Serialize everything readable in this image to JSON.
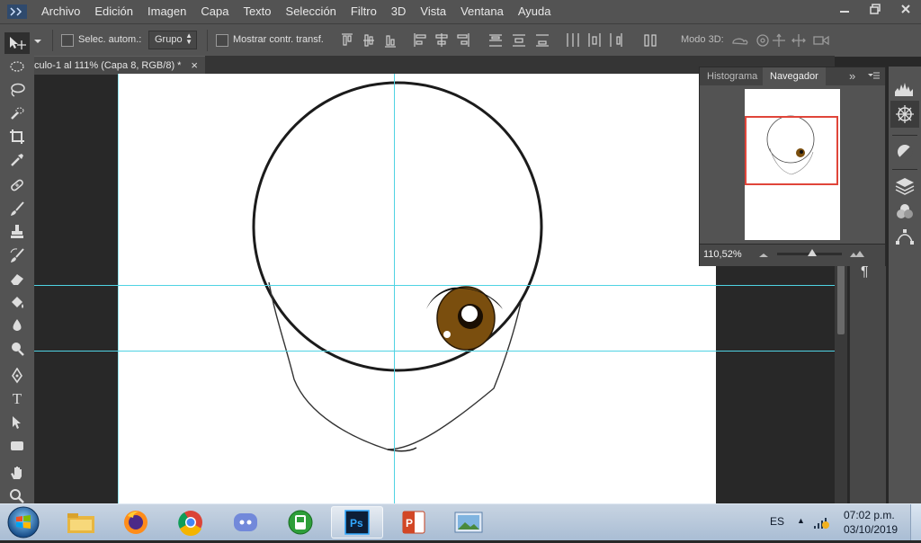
{
  "menu": {
    "items": [
      "Archivo",
      "Edición",
      "Imagen",
      "Capa",
      "Texto",
      "Selección",
      "Filtro",
      "3D",
      "Vista",
      "Ventana",
      "Ayuda"
    ]
  },
  "options_bar": {
    "auto_select_label": "Selec. autom.:",
    "group_select_value": "Grupo",
    "show_transform_label": "Mostrar contr. transf.",
    "mode_3d_label": "Modo 3D:"
  },
  "document": {
    "tab_title": "culo-1 al 111% (Capa 8, RGB/8) *",
    "tab_close": "×"
  },
  "navigator_panel": {
    "tabs": [
      "Histograma",
      "Navegador"
    ],
    "active_tab": "Navegador",
    "zoom_value": "110,52%",
    "double_arrow": "»"
  },
  "side_panel": {
    "paragraph_glyph": "¶"
  },
  "taskbar": {
    "language": "ES",
    "time": "07:02 p.m.",
    "date": "03/10/2019",
    "tray_arrow": "▲"
  },
  "colors": {
    "ui_panel": "#535353",
    "workspace": "#282828",
    "guide": "#4fd3e3",
    "iris": "#7a4e0e",
    "navigator_frame": "#e0453a"
  }
}
